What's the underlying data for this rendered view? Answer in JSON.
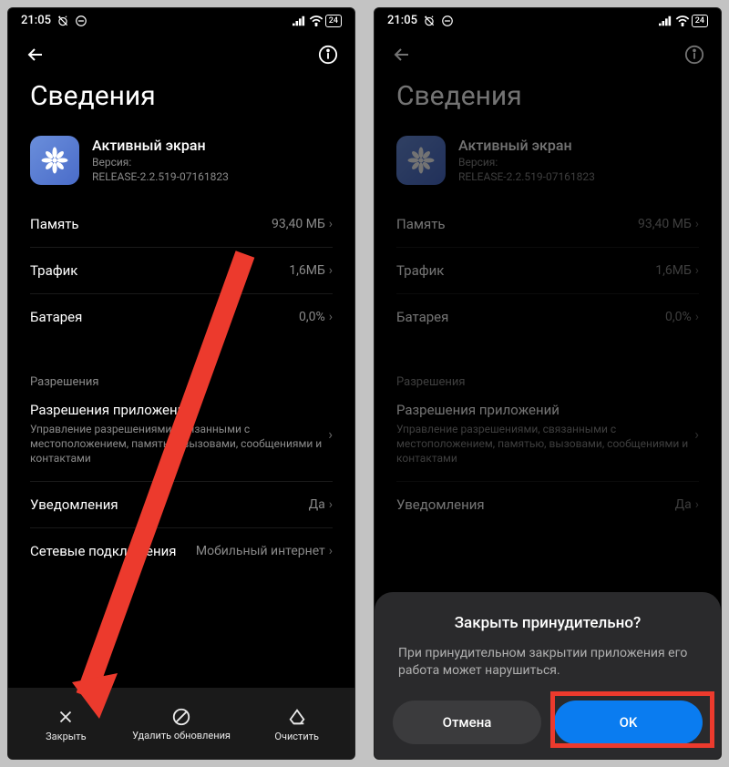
{
  "status": {
    "time": "21:05",
    "battery": "24"
  },
  "page": {
    "title": "Сведения"
  },
  "app": {
    "name": "Активный экран",
    "version_label": "Версия:",
    "version": "RELEASE-2.2.519-07161823"
  },
  "rows": {
    "memory": {
      "label": "Память",
      "value": "93,40 МБ"
    },
    "traffic": {
      "label": "Трафик",
      "value": "1,6МБ"
    },
    "battery": {
      "label": "Батарея",
      "value": "0,0%"
    },
    "notifications": {
      "label": "Уведомления",
      "value": "Да"
    },
    "network": {
      "label": "Сетевые подключения",
      "value": "Мобильный интернет"
    }
  },
  "sections": {
    "permissions_header": "Разрешения",
    "app_permissions_title": "Разрешения приложений",
    "app_permissions_desc": "Управление разрешениями, связанными с местоположением, памятью, вызовами, сообщениями и контактами"
  },
  "bottom": {
    "close": "Закрыть",
    "uninstall": "Удалить обновления",
    "clear": "Очистить"
  },
  "dialog": {
    "title": "Закрыть принудительно?",
    "body": "При принудительном закрытии приложения его работа может нарушиться.",
    "cancel": "Отмена",
    "ok": "OK"
  }
}
